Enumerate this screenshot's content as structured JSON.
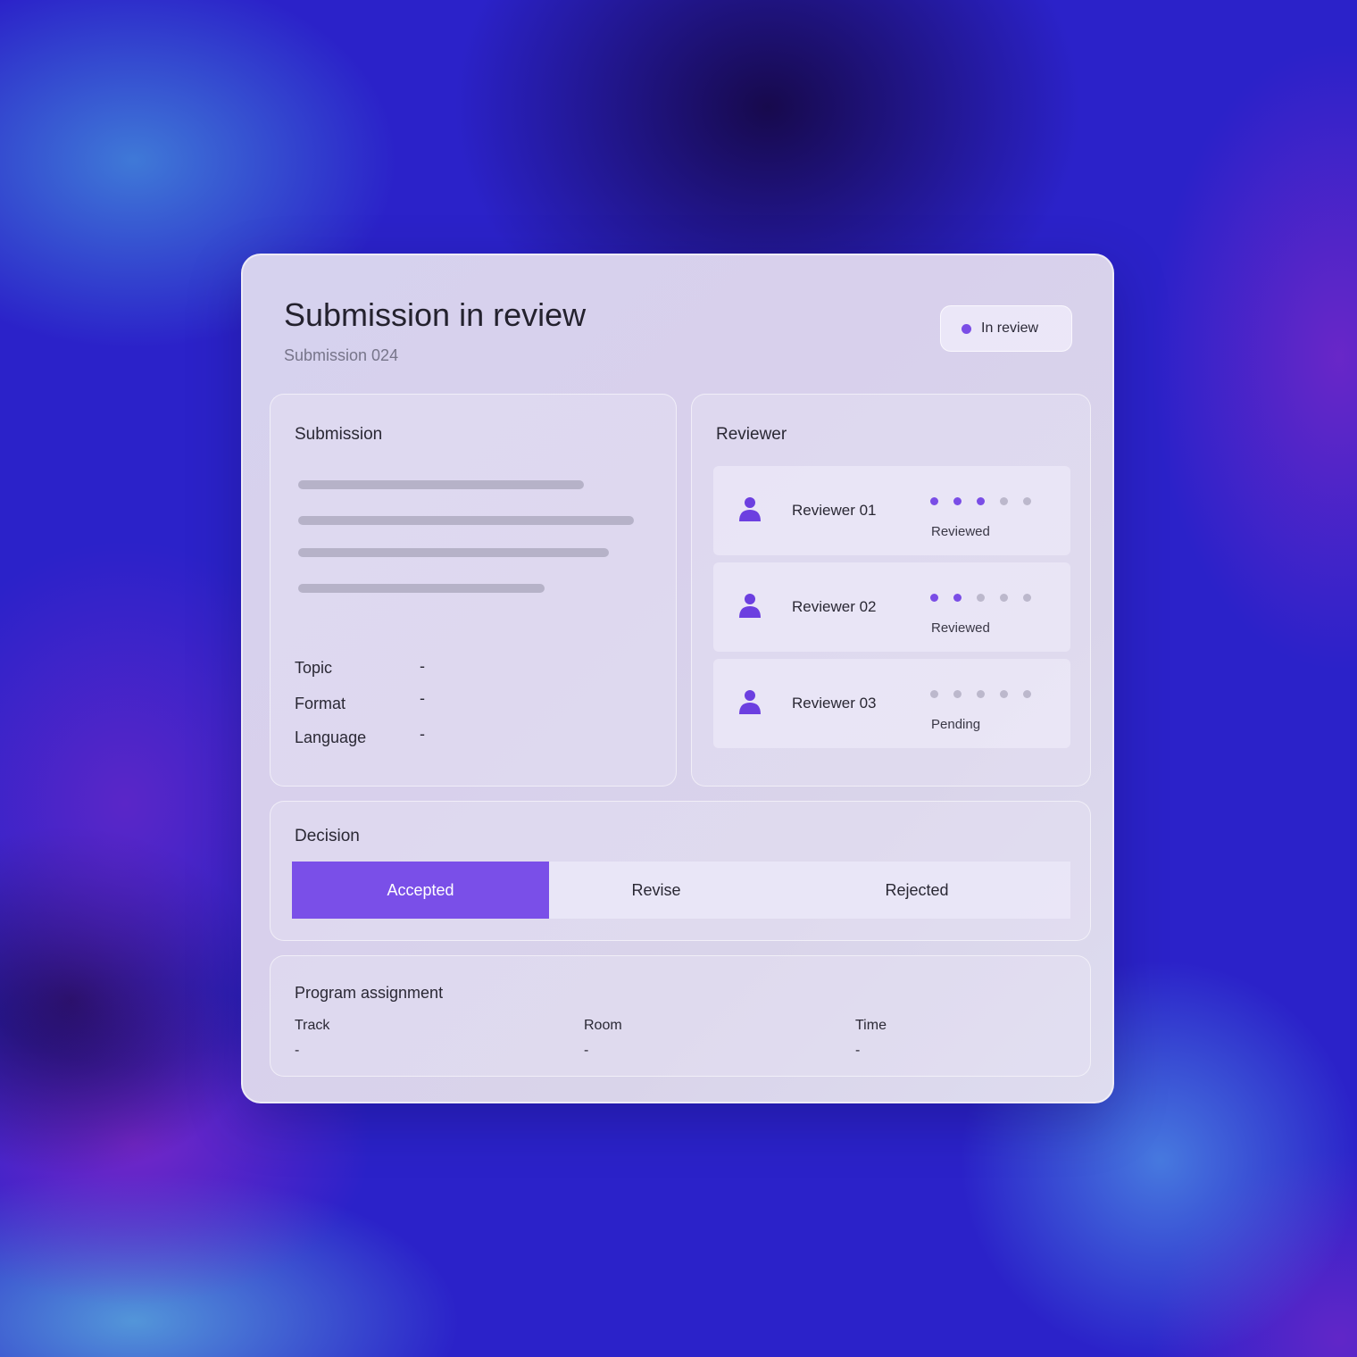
{
  "header": {
    "title": "Submission in review",
    "subtitle": "Submission 024",
    "status_label": "In review",
    "status_color": "#7a4de6"
  },
  "submission": {
    "heading": "Submission",
    "fields": [
      {
        "label": "Topic",
        "value": "-"
      },
      {
        "label": "Format",
        "value": "-"
      },
      {
        "label": "Language",
        "value": "-"
      }
    ]
  },
  "reviewers": {
    "heading": "Reviewer",
    "items": [
      {
        "name": "Reviewer 01",
        "status": "Reviewed",
        "progress": 3,
        "progress_max": 5
      },
      {
        "name": "Reviewer 02",
        "status": "Reviewed",
        "progress": 2,
        "progress_max": 5
      },
      {
        "name": "Reviewer 03",
        "status": "Pending",
        "progress": 0,
        "progress_max": 5
      }
    ]
  },
  "decision": {
    "heading": "Decision",
    "options": [
      "Accepted",
      "Revise",
      "Rejected"
    ],
    "selected": "Accepted",
    "accent_color": "#7a4fe8"
  },
  "program": {
    "heading": "Program assignment",
    "columns": [
      {
        "label": "Track",
        "value": "-"
      },
      {
        "label": "Room",
        "value": "-"
      },
      {
        "label": "Time",
        "value": "-"
      }
    ]
  },
  "icons": {
    "status": "status-dot-icon",
    "reviewer": "person-icon"
  }
}
